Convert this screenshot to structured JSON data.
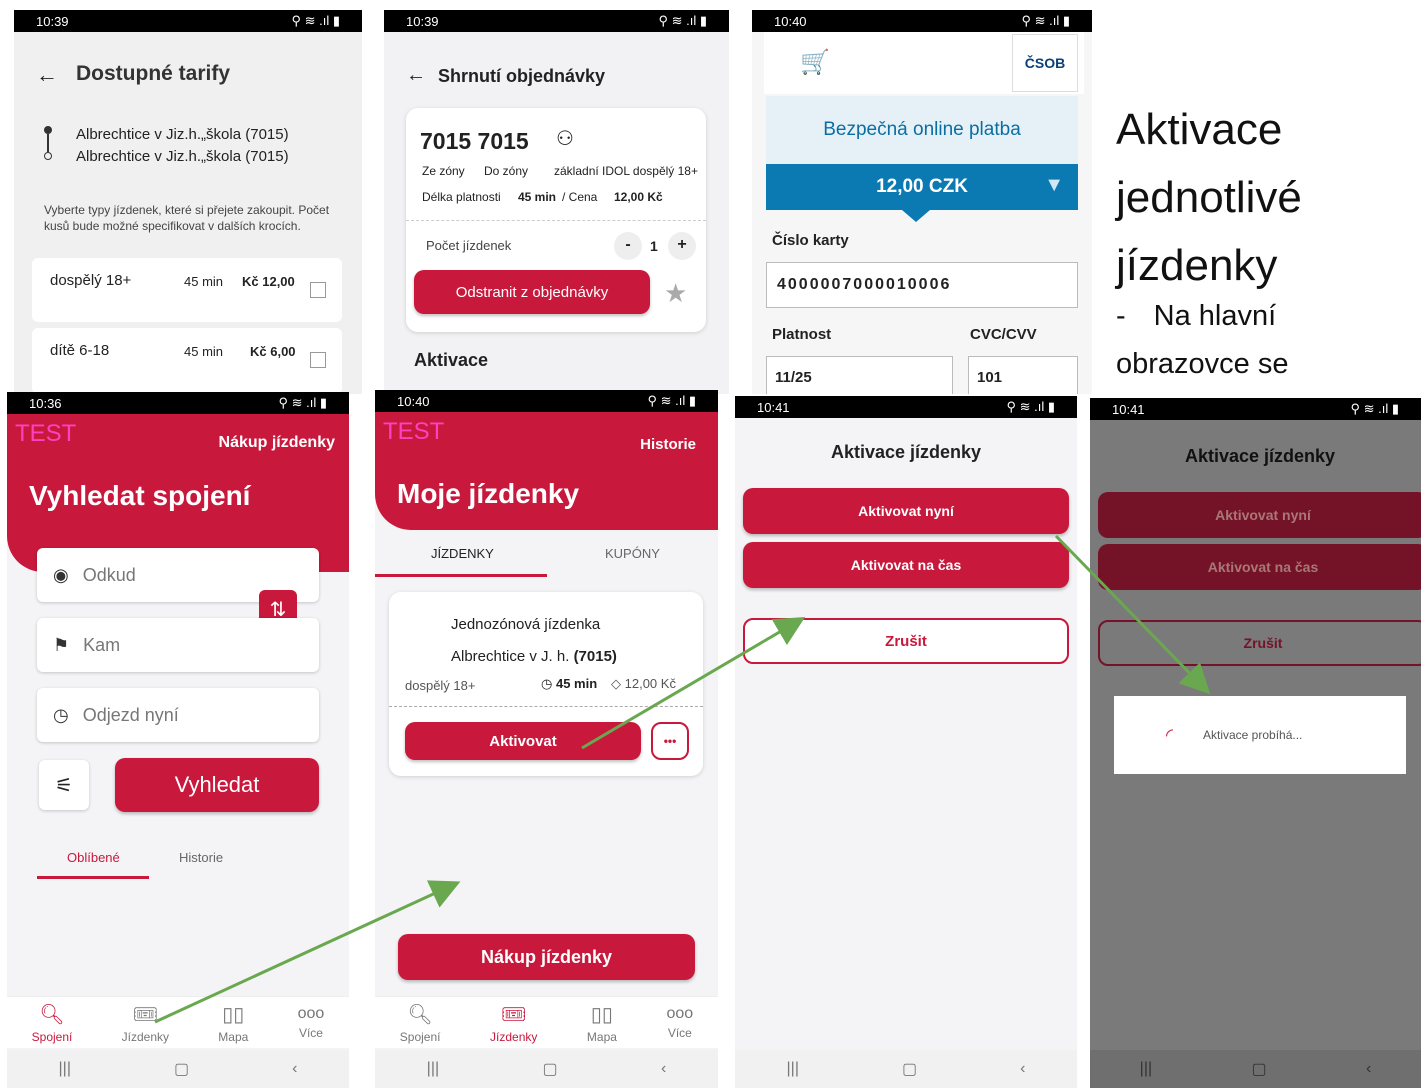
{
  "status_bar": {
    "t1": "10:39",
    "t2": "10:39",
    "t3": "10:40",
    "t4": "10:36",
    "t5": "10:40",
    "t6": "10:41",
    "t7": "10:41"
  },
  "tariffs": {
    "title": "Dostupné tarify",
    "stop_from": "Albrechtice v Jiz.h.„škola (7015)",
    "stop_to": "Albrechtice v Jiz.h.„škola (7015)",
    "desc": "Vyberte typy jízdenek, které si přejete zakoupit. Počet kusů bude možné specifikovat v dalších krocích.",
    "rows": [
      {
        "name": "dospělý 18+",
        "dur": "45 min",
        "price": "Kč 12,00"
      },
      {
        "name": "dítě 6-18",
        "dur": "45 min",
        "price": "Kč 6,00"
      }
    ]
  },
  "summary": {
    "title": "Shrnutí objednávky",
    "ticket_no": "7015 7015",
    "from_zone": "Ze zóny",
    "to_zone": "Do zóny",
    "tariff": "základní IDOL dospělý 18+",
    "validity_label": "Délka platnosti",
    "validity": "45 min",
    "price_label": "/ Cena",
    "price": "12,00 Kč",
    "count_label": "Počet jízdenek",
    "count": "1",
    "minus": "-",
    "plus": "+",
    "remove": "Odstranit z objednávky",
    "activation": "Aktivace"
  },
  "payment": {
    "title": "Bezpečná online platba",
    "amount": "12,00 CZK",
    "bank": "ČSOB",
    "card_label": "Číslo karty",
    "card_value": "4000007000010006",
    "validity_label": "Platnost",
    "cvc_label": "CVC/CVV",
    "validity_value": "11/25",
    "cvc_value": "101"
  },
  "heading": {
    "line1": "Aktivace",
    "line2": "jednotlivé",
    "line3": "jízdenky",
    "bullet": "Na hlavní",
    "line5": "obrazovce se",
    "dash": "-"
  },
  "search": {
    "test": "TEST",
    "buy": "Nákup jízdenky",
    "title": "Vyhledat spojení",
    "from": "Odkud",
    "to": "Kam",
    "depart": "Odjezd nyní",
    "search_btn": "Vyhledat",
    "tab_fav": "Oblíbené",
    "tab_hist": "Historie"
  },
  "nav": {
    "spojeni": "Spojení",
    "jizdenky": "Jízdenky",
    "mapa": "Mapa",
    "vice": "Více"
  },
  "mytickets": {
    "test": "TEST",
    "history": "Historie",
    "title": "Moje jízdenky",
    "tab1": "JÍZDENKY",
    "tab2": "KUPÓNY",
    "ticket_name": "Jednozónová jízdenka",
    "stop": "Albrechtice v J. h.",
    "stop_code": "(7015)",
    "type": "dospělý 18+",
    "dur": "45 min",
    "price": "12,00 Kč",
    "activate": "Aktivovat",
    "dots": "•••",
    "buy": "Nákup jízdenky"
  },
  "activation": {
    "title": "Aktivace jízdenky",
    "now": "Aktivovat nyní",
    "timed": "Aktivovat na čas",
    "cancel": "Zrušit",
    "progress": "Aktivace probíhá..."
  }
}
